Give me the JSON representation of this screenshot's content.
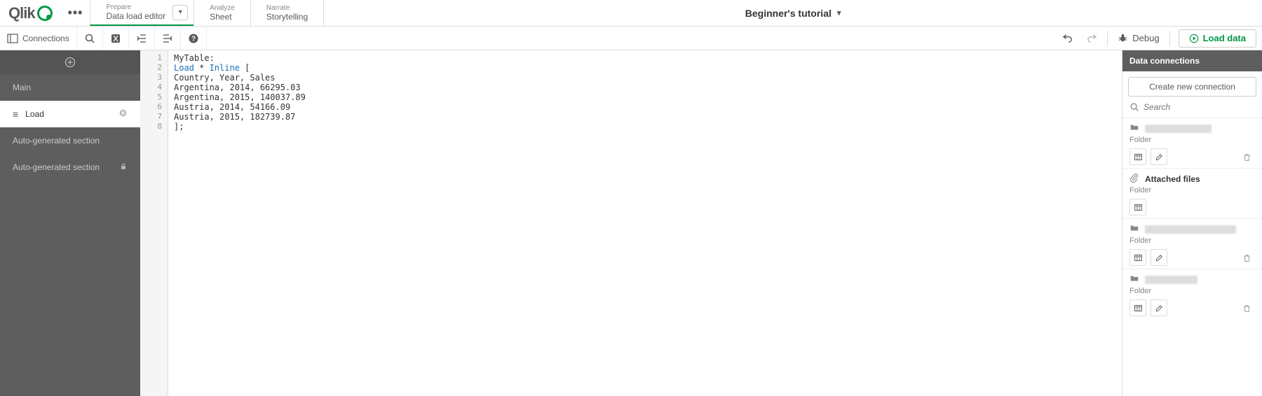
{
  "logo": "Qlik",
  "nav": {
    "prepare": {
      "small": "Prepare",
      "big": "Data load editor"
    },
    "analyze": {
      "small": "Analyze",
      "big": "Sheet"
    },
    "narrate": {
      "small": "Narrate",
      "big": "Storytelling"
    }
  },
  "app_title": "Beginner's tutorial",
  "toolbar": {
    "connections": "Connections",
    "debug": "Debug",
    "load_data": "Load data"
  },
  "sidebar": {
    "main": "Main",
    "load": "Load",
    "auto1": "Auto-generated section",
    "auto2": "Auto-generated section"
  },
  "code": {
    "lines": [
      "1",
      "2",
      "3",
      "4",
      "5",
      "6",
      "7",
      "8"
    ],
    "l1_a": "MyTable",
    "l1_b": ":",
    "l2_a": "Load",
    "l2_b": " * ",
    "l2_c": "Inline",
    "l2_d": " [",
    "l3": "Country, Year, Sales",
    "l4": "Argentina, 2014, 66295.03",
    "l5": "Argentina, 2015, 140037.89",
    "l6": "Austria, 2014, 54166.09",
    "l7": "Austria, 2015, 182739.87",
    "l8": "];"
  },
  "rightpanel": {
    "title": "Data connections",
    "create": "Create new connection",
    "search_placeholder": "Search",
    "folder_label": "Folder",
    "attached_label": "Attached files"
  }
}
